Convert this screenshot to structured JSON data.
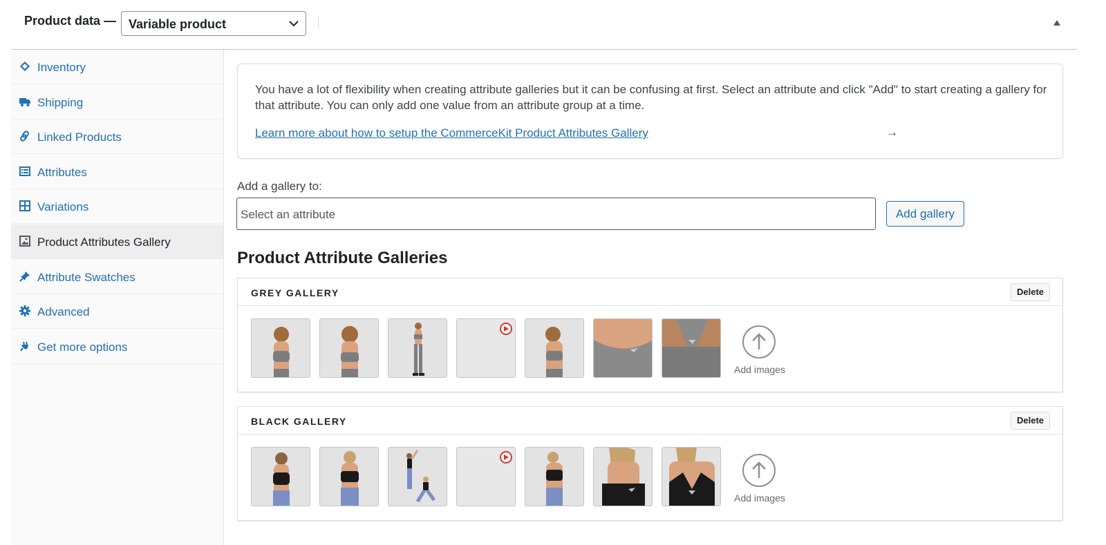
{
  "header": {
    "title": "Product data —",
    "product_type": "Variable product"
  },
  "sidebar": {
    "items": [
      {
        "label": "Inventory",
        "icon": "tag-icon"
      },
      {
        "label": "Shipping",
        "icon": "truck-icon"
      },
      {
        "label": "Linked Products",
        "icon": "link-icon"
      },
      {
        "label": "Attributes",
        "icon": "list-icon"
      },
      {
        "label": "Variations",
        "icon": "grid-icon"
      },
      {
        "label": "Product Attributes Gallery",
        "icon": "image-icon",
        "active": true
      },
      {
        "label": "Attribute Swatches",
        "icon": "pin-icon"
      },
      {
        "label": "Advanced",
        "icon": "gear-icon"
      },
      {
        "label": "Get more options",
        "icon": "plugin-icon"
      }
    ]
  },
  "notice": {
    "text": "You have a lot of flexibility when creating attribute galleries but it can be confusing at first. Select an attribute and click \"Add\" to start creating a gallery for that attribute. You can only add one value from an attribute group at a time.",
    "link": "Learn more about how to setup the CommerceKit Product Attributes Gallery",
    "arrow": "→"
  },
  "add_gallery": {
    "label": "Add a gallery to:",
    "placeholder": "Select an attribute",
    "button": "Add gallery"
  },
  "section_title": "Product Attribute Galleries",
  "galleries": [
    {
      "name": "GREY GALLERY",
      "delete": "Delete",
      "add_images": "Add images",
      "images": 7,
      "video_slot": 4
    },
    {
      "name": "BLACK GALLERY",
      "delete": "Delete",
      "add_images": "Add images",
      "images": 7,
      "video_slot": 4
    }
  ],
  "colors": {
    "link": "#2271b1",
    "text": "#1d2327",
    "video_icon": "#d63638",
    "grey_top": "#7d7d7d",
    "black_top": "#1a1a1a",
    "blue_shorts": "#7b8fc4",
    "skin": "#d9a37f"
  }
}
